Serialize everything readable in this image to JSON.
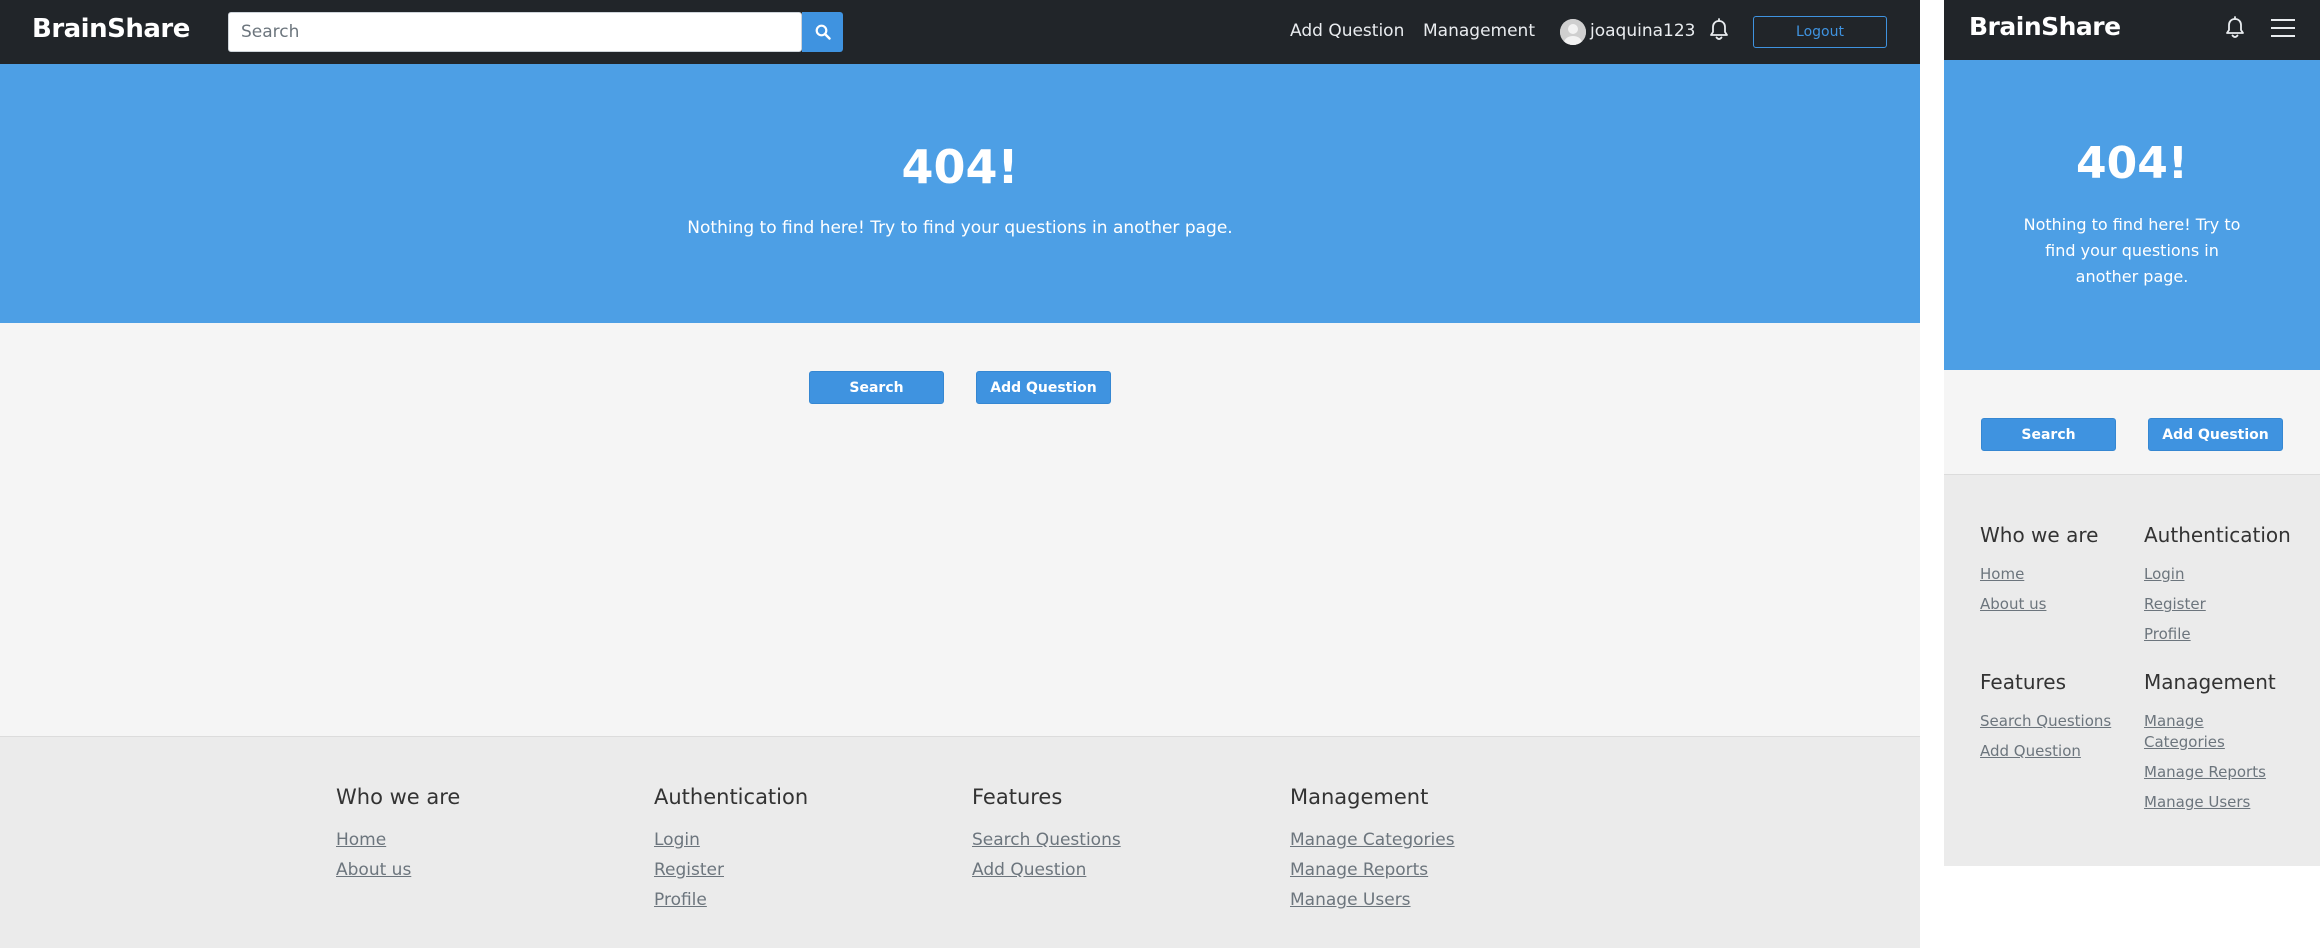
{
  "brand": "BrainShare",
  "navbar": {
    "search_placeholder": "Search",
    "add_question": "Add Question",
    "management": "Management",
    "username": "joaquina123",
    "logout": "Logout"
  },
  "hero": {
    "title": "404!",
    "message": "Nothing to find here! Try to find your questions in another page."
  },
  "actions": {
    "search": "Search",
    "add_question": "Add Question"
  },
  "footer": {
    "who": {
      "title": "Who we are",
      "links": [
        "Home",
        "About us"
      ]
    },
    "auth": {
      "title": "Authentication",
      "links": [
        "Login",
        "Register",
        "Profile"
      ]
    },
    "features": {
      "title": "Features",
      "links": [
        "Search Questions",
        "Add Question"
      ]
    },
    "management": {
      "title": "Management",
      "links": [
        "Manage Categories",
        "Manage Reports",
        "Manage Users"
      ]
    }
  },
  "mobile": {
    "management_links": [
      "Manage",
      "Categories",
      "Manage Reports",
      "Manage Users"
    ]
  },
  "colors": {
    "navbar": "#212529",
    "accent": "#3f93e0",
    "hero": "#4d9fe5",
    "page_bg": "#f5f5f5",
    "footer_bg": "#ebebeb"
  },
  "icons": {
    "search": "search-icon",
    "notifications": "bell-icon",
    "user": "avatar-icon",
    "menu": "hamburger-menu-icon"
  }
}
